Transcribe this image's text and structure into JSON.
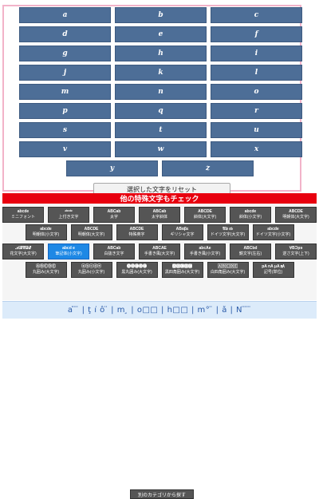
{
  "keyboard": {
    "rows": [
      [
        "a",
        "b",
        "c"
      ],
      [
        "d",
        "e",
        "f"
      ],
      [
        "g",
        "h",
        "i"
      ],
      [
        "j",
        "k",
        "l"
      ],
      [
        "m",
        "n",
        "o"
      ],
      [
        "p",
        "q",
        "r"
      ],
      [
        "s",
        "t",
        "u"
      ],
      [
        "v",
        "w",
        "x"
      ],
      [
        "y",
        "z"
      ]
    ]
  },
  "reset_label": "選択した文字をリセット",
  "section_title": "他の特殊文字もチェック",
  "font_rows": [
    [
      {
        "sample": "abcde",
        "name": "ミニフォント"
      },
      {
        "sample": "ᵃᵇᶜᵈᵉ",
        "name": "上付き文字"
      },
      {
        "sample": "ABCab",
        "name": "太字"
      },
      {
        "sample": "ABCab",
        "name": "太字斜体"
      },
      {
        "sample": "ABCDE",
        "name": "斜体(大文字)"
      },
      {
        "sample": "abcde",
        "name": "斜体(小文字)"
      },
      {
        "sample": "ABCDE",
        "name": "明朝体(大文字)"
      }
    ],
    [
      {
        "sample": "abcde",
        "name": "明朝体(小文字)"
      },
      {
        "sample": "ABCDE",
        "name": "明朝体(大文字)"
      },
      {
        "sample": "ABCDE",
        "name": "特殊英字"
      },
      {
        "sample": "ABαβε",
        "name": "ギリシャ文字"
      },
      {
        "sample": "𝔄𝔅 𝔞𝔟",
        "name": "ドイツ文字(大文字)"
      },
      {
        "sample": "abcde",
        "name": "ドイツ文字(小文字)"
      }
    ],
    [
      {
        "sample": "𝒜ℬ𝒞𝒟ℰ",
        "name": "花文字(大文字)"
      },
      {
        "sample": "abcd e",
        "name": "筆記体(小文字)",
        "active": true
      },
      {
        "sample": "ABCab",
        "name": "白抜き文字"
      },
      {
        "sample": "ABCAE",
        "name": "手書き風(大文字)"
      },
      {
        "sample": "abcAe",
        "name": "手書き風(小文字)"
      },
      {
        "sample": "ABCbd",
        "name": "鏡文字(左右)"
      },
      {
        "sample": "∀BƆpɘ",
        "name": "逆さ文字(上下)"
      }
    ],
    [
      {
        "sample": "ⒶⒷⒸⒹⒺ",
        "name": "丸囲み(大文字)"
      },
      {
        "sample": "ⓐⓑⓒⓓⓔ",
        "name": "丸囲み(小文字)"
      },
      {
        "sample": "🅐🅑🅒🅓🅔",
        "name": "黒丸囲み(大文字)"
      },
      {
        "sample": "🅰🅱🅲🅳🅴",
        "name": "黒四角囲み(大文字)"
      },
      {
        "sample": "🄰🄱🄲🄳🄴",
        "name": "白四角囲み(大文字)"
      },
      {
        "sample": "pA nA μA ㎃",
        "name": "記号(単位)"
      }
    ]
  ],
  "other_categories_label": "別のカテゴリから探す",
  "preview_text": "a͘ ̈ ̈  |  ţ ı͘ ô ̈  |  m ̧ |  o□□  |  h□□  |  m° ̈  |  ǎ  |  N ̈ ̈ ̈"
}
